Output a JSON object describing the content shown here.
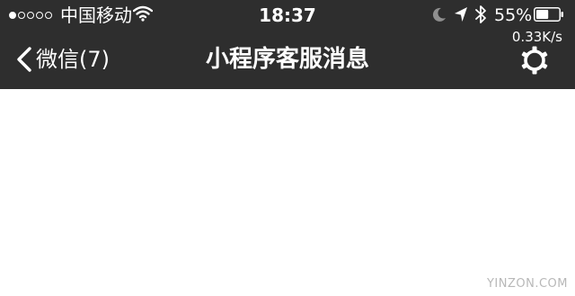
{
  "status_bar": {
    "signal_dots_filled": 1,
    "signal_dots_total": 5,
    "carrier": "中国移动",
    "time": "18:37",
    "battery_percent": "55%",
    "battery_level": 0.55,
    "icons": [
      "wifi-icon",
      "moon-icon",
      "location-arrow-icon",
      "bluetooth-icon",
      "battery-icon"
    ]
  },
  "nav": {
    "back_label": "微信(7)",
    "title": "小程序客服消息",
    "network_speed": "0.33K/s",
    "settings_icon": "gear-icon"
  },
  "watermark": "YINZON.COM",
  "colors": {
    "nav_background": "#2e2e2e",
    "nav_text": "#ffffff",
    "content_background": "#ffffff",
    "watermark": "#b8b8b8"
  }
}
